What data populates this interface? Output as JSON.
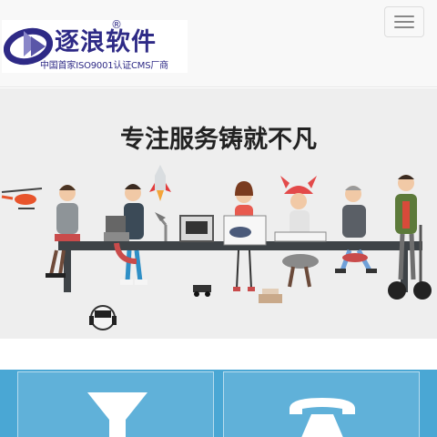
{
  "header": {
    "logo_title": "逐浪软件",
    "logo_registered": "®",
    "logo_subtitle": "中国首家ISO9001认证CMS厂商",
    "menu_toggle_label": "Toggle navigation"
  },
  "banner": {
    "slogan": "专注服务铸就不凡"
  },
  "features": {
    "cards": [
      {
        "icon": "funnel-icon"
      },
      {
        "icon": "phone-icon"
      }
    ]
  },
  "colors": {
    "brand": "#2e2a86",
    "nav_bg": "#f8f8f8",
    "banner_bg": "#eeeeee",
    "features_bg": "#4aa7d4"
  }
}
